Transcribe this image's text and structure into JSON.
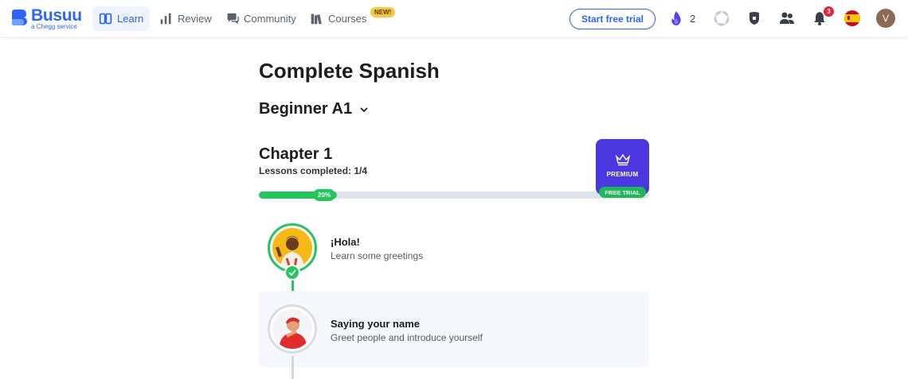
{
  "brand": {
    "name": "Busuu",
    "tagline": "a Chegg service",
    "color": "#2c64f6"
  },
  "nav": {
    "items": [
      {
        "label": "Learn",
        "icon": "book-icon",
        "active": true
      },
      {
        "label": "Review",
        "icon": "bar-chart-icon"
      },
      {
        "label": "Community",
        "icon": "chat-icon"
      },
      {
        "label": "Courses",
        "icon": "books-icon"
      }
    ],
    "new_badge": "NEW!"
  },
  "header": {
    "trial_button": "Start free trial",
    "streak_count": "2",
    "notifications_count": "3",
    "avatar_initial": "V",
    "icons": [
      "flame-icon",
      "progress-ring-icon",
      "shield-icon",
      "friends-icon",
      "bell-icon",
      "spain-flag-icon"
    ]
  },
  "course": {
    "title": "Complete Spanish",
    "level": "Beginner A1",
    "chapter": {
      "title": "Chapter 1",
      "lessons_completed": "Lessons completed: 1/4",
      "progress": 0.2,
      "progress_label": "20%"
    },
    "premium": {
      "label": "PREMIUM",
      "tag": "FREE TRIAL",
      "color": "#4a37e0"
    },
    "lessons": [
      {
        "title": "¡Hola!",
        "subtitle": "Learn some greetings",
        "completed": true
      },
      {
        "title": "Saying your name",
        "subtitle": "Greet people and introduce yourself",
        "completed": false
      }
    ]
  },
  "colors": {
    "success": "#22c55e",
    "accent": "#2c64f6",
    "premium": "#4a37e0",
    "alert": "#e5233b"
  }
}
